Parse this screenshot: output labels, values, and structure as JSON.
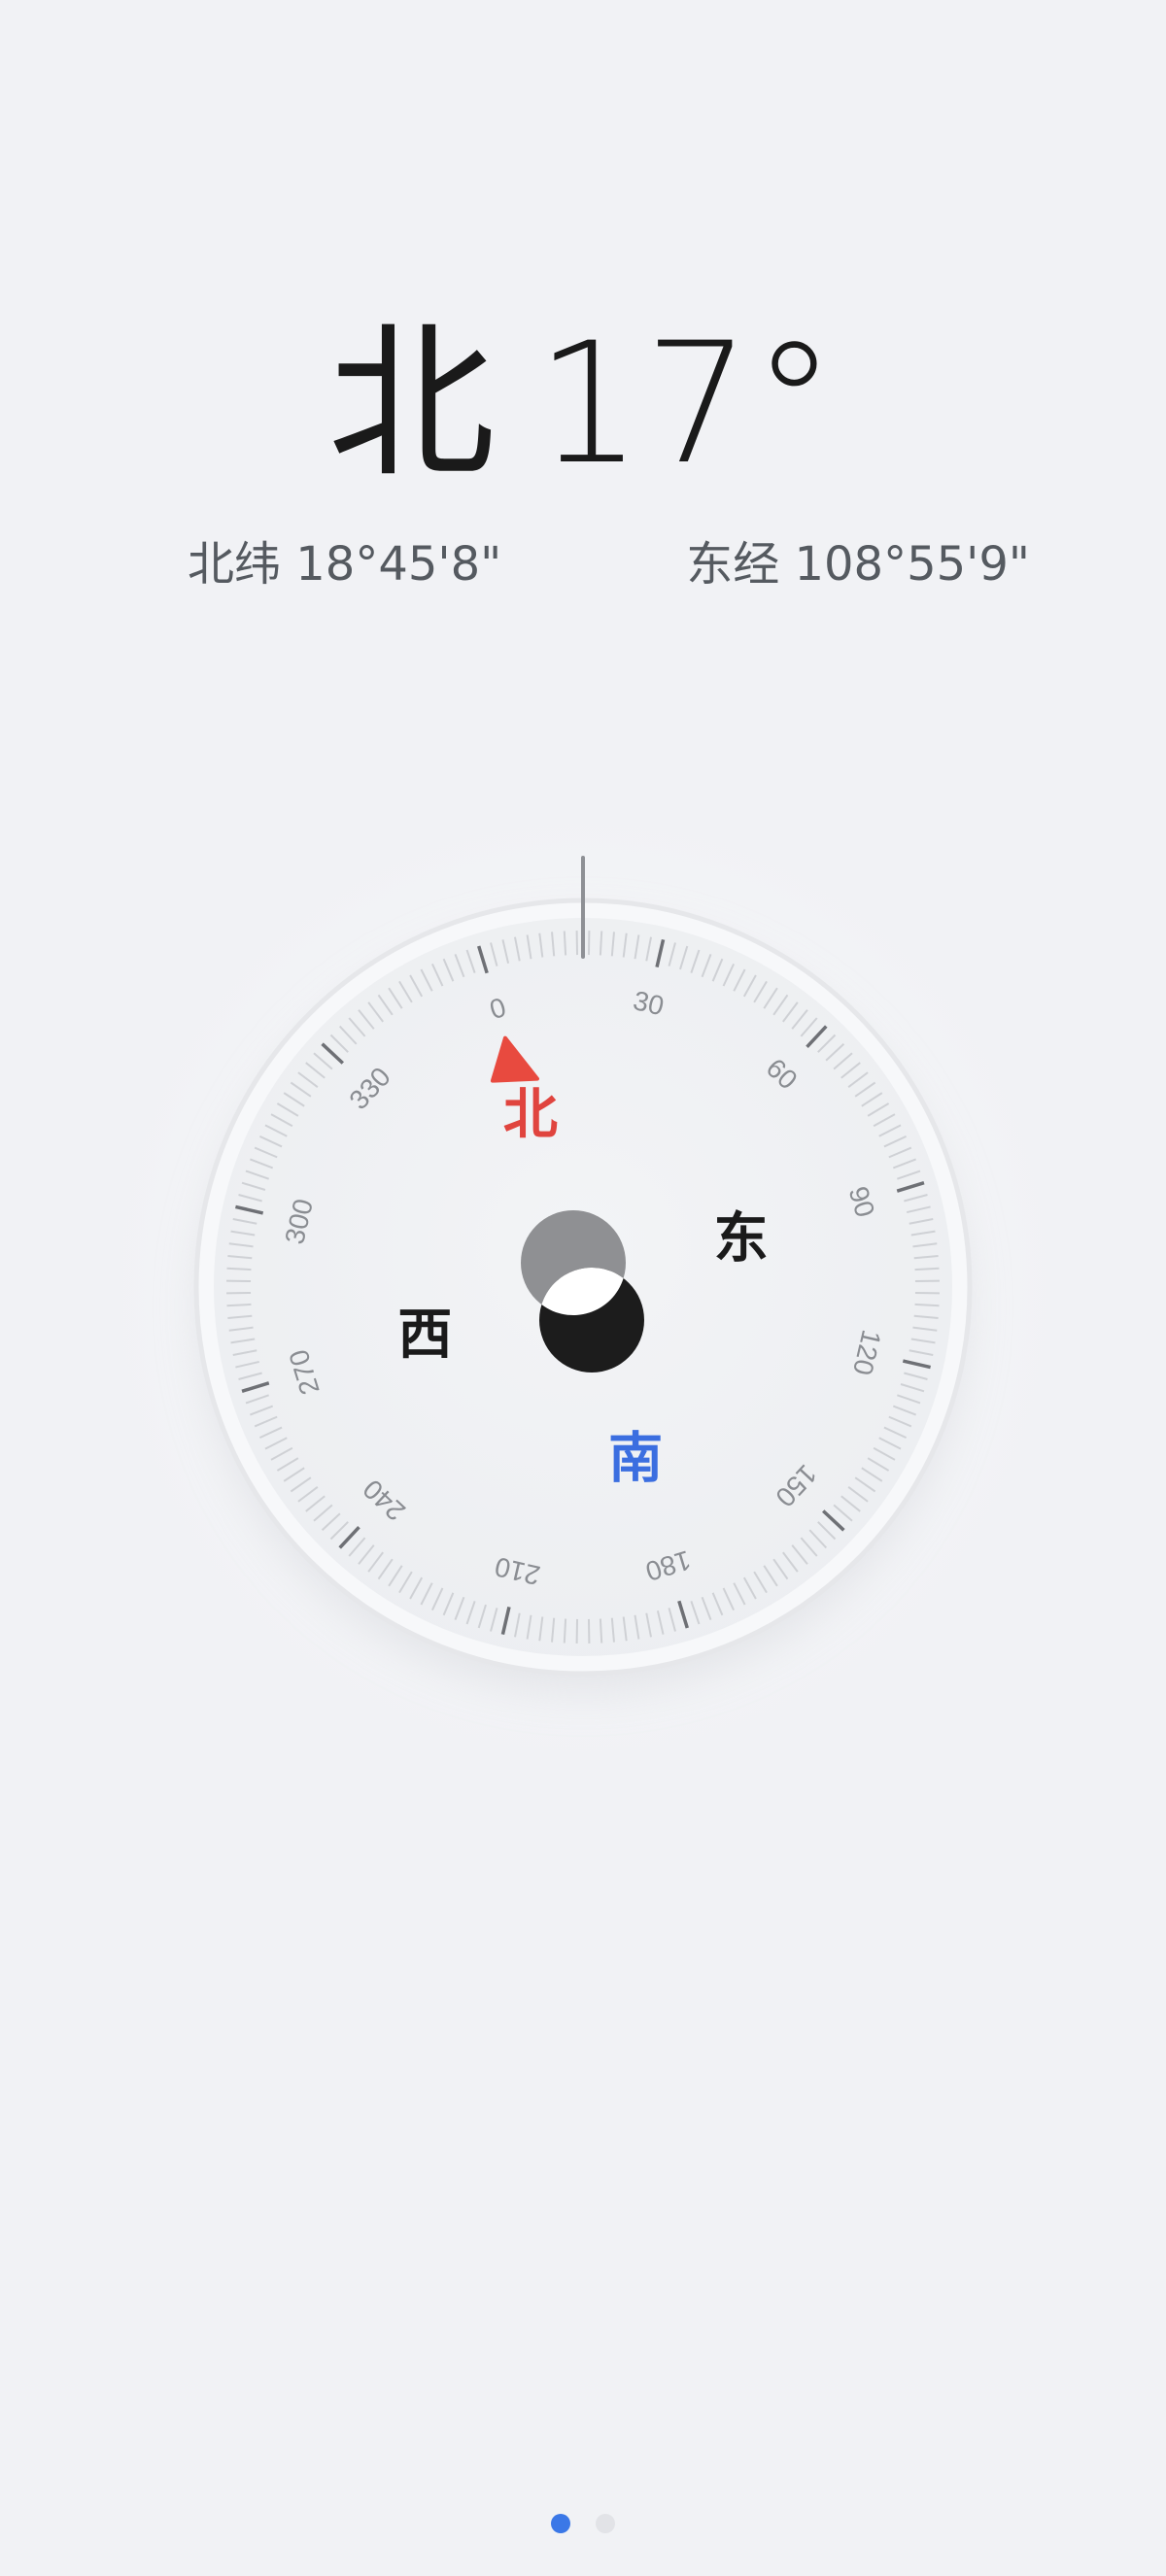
{
  "heading": {
    "direction": "北",
    "degrees": "17°"
  },
  "location": {
    "latitude_label": "北纬 18°45'8\"",
    "longitude_label": "东经 108°55'9\""
  },
  "compass": {
    "heading_value": 17,
    "tick_labels": [
      "0",
      "30",
      "60",
      "90",
      "120",
      "150",
      "180",
      "210",
      "240",
      "270",
      "300",
      "330"
    ],
    "cardinals": {
      "north": "北",
      "east": "东",
      "south": "南",
      "west": "西"
    },
    "colors": {
      "north": "#e0443e",
      "south": "#3b6ee0",
      "east_west": "#1a1a1a",
      "north_marker": "#e84a3f"
    }
  },
  "pager": {
    "pages": 2,
    "active_index": 0
  }
}
